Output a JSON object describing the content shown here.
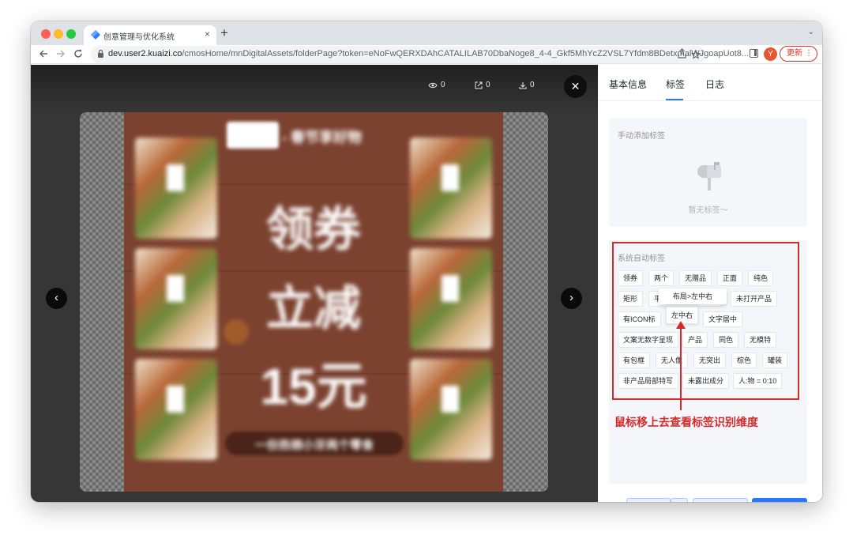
{
  "browser": {
    "tab_title": "创意管理与优化系统",
    "tab_close": "×",
    "new_tab": "+",
    "tab_menu": "⌄",
    "url_host": "dev.user2.kuaizi.co",
    "url_path": "/cmosHome/mnDigitalAssets/folderPage?token=eNoFwQERXDAhCATALILAB70DbaNoge8_4-4_Gkf5MhYcZ2VSL7Yfdm8BDetxmalWJgoapUot8...",
    "avatar_letter": "Y",
    "update_label": "更新",
    "update_kebab": "⋮"
  },
  "viewer": {
    "stats": [
      {
        "icon": "eye-icon",
        "value": "0"
      },
      {
        "icon": "share-icon",
        "value": "0"
      },
      {
        "icon": "download-icon",
        "value": "0"
      }
    ],
    "close_glyph": "✕",
    "prev_glyph": "‹",
    "next_glyph": "›",
    "poster": {
      "header_text": "- 春节享好物",
      "line1": "领券",
      "line2": "立减",
      "line3": "15元",
      "banner": "一份热销小牙两个零食"
    }
  },
  "panel": {
    "tabs": [
      "基本信息",
      "标签",
      "日志"
    ],
    "active_tab": "标签",
    "manual_section": {
      "title": "手动添加标签",
      "empty_text": "暂无标签～"
    },
    "auto_section": {
      "title": "系统自动标签",
      "tags": [
        "领券",
        "两个",
        "无赠品",
        "正面",
        "纯色",
        "矩形",
        "平",
        "组合",
        "未打开产品",
        "有ICON标",
        "文字居中",
        "文案无数字呈现",
        "产品",
        "同色",
        "无模特",
        "有包框",
        "无人像",
        "无突出",
        "棕色",
        "罐装",
        "非产品局部特写",
        "未露出成分",
        "人:物 = 0:10"
      ],
      "hover_tag": "左中右",
      "tooltip": "布局>左中右"
    },
    "annotation": "鼠标移上去查看标签识别维度",
    "buttons": {
      "download": "下载",
      "more": "···",
      "edit": "编辑",
      "share": "分享"
    }
  },
  "colors": {
    "accent": "#2878ff",
    "annotation_red": "#d52b2b",
    "poster_brown": "#7c4230"
  }
}
